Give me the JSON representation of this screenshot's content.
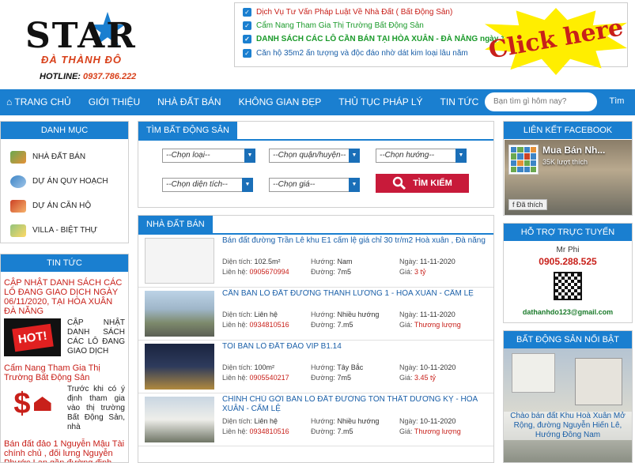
{
  "header": {
    "logo_text": "STAR",
    "logo_sub": "ĐÀ THÀNH ĐÔ",
    "hotline_label": "HOTLINE:",
    "hotline_number": "0937.786.222",
    "news": [
      {
        "text": "Dịch Vụ Tư Vấn Pháp Luật Về Nhà Đất ( Bất Động Sản)",
        "color": "#c8201a"
      },
      {
        "text": "Cẩm Nang Tham Gia Thị Trường Bất Động Sản",
        "color": "#1a9a2a"
      },
      {
        "text": "DANH SÁCH CÁC LÔ CẦN BÁN TẠI HÒA XUÂN - ĐÀ NẴNG ngày 11/9/2020",
        "color": "#1a9a2a"
      },
      {
        "text": "Căn hộ 35m2 ấn tượng và độc đáo nhờ dát kim loại lâu năm",
        "color": "#1a5fa8"
      }
    ],
    "click_here": "Click here"
  },
  "nav": {
    "items": [
      "TRANG CHỦ",
      "GIỚI THIỆU",
      "NHÀ ĐẤT BÁN",
      "KHÔNG GIAN ĐẸP",
      "THỦ TỤC PHÁP LÝ",
      "TIN TỨC",
      "LIÊN HỆ"
    ],
    "search_placeholder": "Bạn tìm gì hôm nay?",
    "search_button": "Tìm"
  },
  "danhmuc": {
    "title": "DANH MỤC",
    "items": [
      "NHÀ ĐẤT BÁN",
      "DỰ ÁN QUY HOẠCH",
      "DỰ ÁN CĂN HỘ",
      "VILLA - BIỆT THỰ"
    ]
  },
  "tintuc": {
    "title": "TIN TỨC",
    "posts": [
      {
        "title": "CẬP NHẬT DANH SÁCH CÁC LÔ ĐANG GIAO DỊCH NGÀY 06/11/2020, TẠI HÒA XUÂN ĐÀ NẴNG",
        "excerpt": "CẬP NHẬT DANH SÁCH CÁC LÔ ĐANG GIAO DỊCH",
        "thumb_label": "HOT!"
      },
      {
        "title": "Cẩm Nang Tham Gia Thị Trường Bất Động Sản",
        "excerpt": "Trước khi có ý định tham gia vào thị trường Bất Động Sản, nhà",
        "thumb_label": "$"
      },
      {
        "title": "Bán đất đảo 1 Nguyễn Mậu Tài chính chủ , đối lưng Nguyễn Phước Lan gần đường đinh, Hoà",
        "excerpt": "",
        "thumb_label": ""
      }
    ]
  },
  "search": {
    "title": "TÌM BẤT ĐỘNG SẢN",
    "selects": [
      "--Chọn loại--",
      "--Chọn quận/huyện--",
      "--Chọn hướng--",
      "--Chọn diện tích--",
      "--Chọn giá--"
    ],
    "button": "TÌM KIẾM"
  },
  "listings": {
    "title": "NHÀ ĐẤT BÁN",
    "labels": {
      "area": "Diện tích:",
      "phone": "Liên hệ:",
      "direction": "Hướng:",
      "road": "Đường:",
      "date": "Ngày:",
      "price": "Giá:"
    },
    "items": [
      {
        "title": "Bán đất đường Trần Lê khu E1 cẩm lệ giá chỉ 30 tr/m2 Hoà xuân , Đà nẵng",
        "area": "102.5m²",
        "phone": "0905670994",
        "direction": "Nam",
        "road": "7m5",
        "date": "11-11-2020",
        "price": "3 tỷ"
      },
      {
        "title": "CẦN BÁN LÔ ĐẤT ĐƯỜNG THANH LƯƠNG 1 - HÒA XUÂN - CẨM LỆ",
        "area": "Liên hệ",
        "phone": "0934810516",
        "direction": "Nhiều hướng",
        "road": "7.m5",
        "date": "11-11-2020",
        "price": "Thương lượng"
      },
      {
        "title": "TÔI BÁN LÔ ĐẤT ĐẢO VIP B1.14",
        "area": "100m²",
        "phone": "0905540217",
        "direction": "Tây Bắc",
        "road": "7m5",
        "date": "10-11-2020",
        "price": "3.45 tỷ"
      },
      {
        "title": "CHÍNH CHỦ GỞI BÁN LÔ ĐẤT ĐƯỜNG TÔN THẤT DƯƠNG KỴ - HÒA XUÂN - CẨM LỆ",
        "area": "Liên hệ",
        "phone": "0934810516",
        "direction": "Nhiều hướng",
        "road": "7.m5",
        "date": "10-11-2020",
        "price": "Thương lượng"
      }
    ]
  },
  "facebook": {
    "title": "LIÊN KẾT FACEBOOK",
    "page_name": "Mua Bán Nh...",
    "likes": "35K lượt thích",
    "like_button": "Đã thích"
  },
  "support": {
    "title": "HỖ TRỢ TRỰC TUYẾN",
    "name": "Mr Phi",
    "phone": "0905.288.525",
    "email": "dathanhdo123@gmail.com"
  },
  "featured": {
    "title": "BẤT ĐỘNG SẢN NỔI BẬT",
    "caption": "Chào bán đất Khu Hoà Xuân Mở Rộng, đường Nguyễn Hiến Lê, Hướng Đông Nam"
  },
  "colors": {
    "brand_blue": "#1a7fd0",
    "accent_red": "#c8201a",
    "button_red": "#c81a3a"
  }
}
